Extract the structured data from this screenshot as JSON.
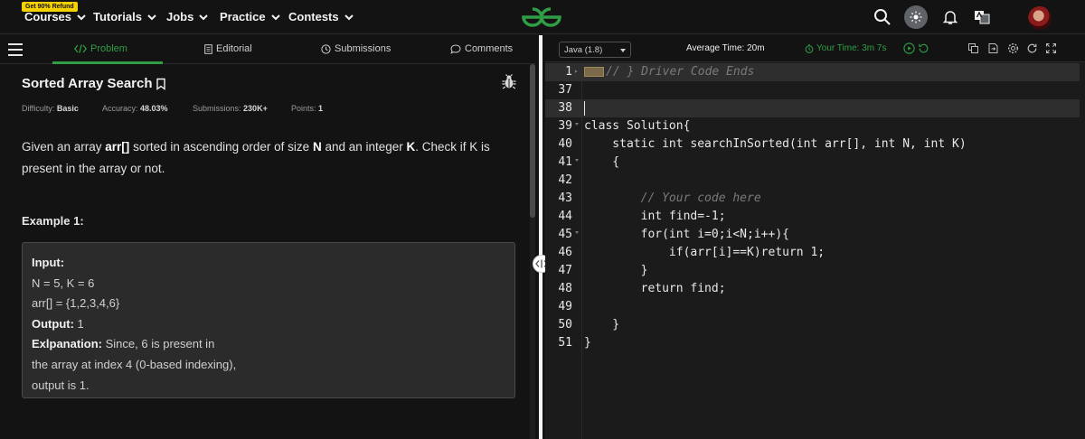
{
  "nav": {
    "refund_badge": "Get 90% Refund",
    "items": [
      "Courses",
      "Tutorials",
      "Jobs",
      "Practice",
      "Contests"
    ]
  },
  "tabs": {
    "problem": "Problem",
    "editorial": "Editorial",
    "submissions": "Submissions",
    "comments": "Comments"
  },
  "problem": {
    "title": "Sorted Array Search",
    "difficulty_label": "Difficulty:",
    "difficulty": "Basic",
    "accuracy_label": "Accuracy:",
    "accuracy": "48.03%",
    "submissions_label": "Submissions:",
    "submissions": "230K+",
    "points_label": "Points:",
    "points": "1",
    "desc_1": "Given an array ",
    "desc_arr": "arr[]",
    "desc_2": " sorted in ascending order of size ",
    "desc_n": "N",
    "desc_3": " and an integer ",
    "desc_k": "K",
    "desc_4": ". Check if K is present in the array or not.",
    "example_title": "Example 1:",
    "example": {
      "input_label": "Input:",
      "line1": "N = 5, K = 6",
      "line2": "arr[] = {1,2,3,4,6}",
      "output_label": "Output:",
      "output_value": " 1",
      "expl_label": "Exlpanation:",
      "expl_1": " Since, 6 is present in",
      "expl_2": "the array at index 4 (0-based indexing),",
      "expl_3": "output is 1."
    }
  },
  "editor": {
    "language": "Java (1.8)",
    "avg_time": "Average Time: 20m",
    "your_time": "Your Time: 3m 7s",
    "lines": [
      {
        "n": "1",
        "code": "// } Driver Code Ends"
      },
      {
        "n": "37",
        "code": ""
      },
      {
        "n": "38",
        "code": ""
      },
      {
        "n": "39",
        "code": "class Solution{"
      },
      {
        "n": "40",
        "code": "    static int searchInSorted(int arr[], int N, int K)"
      },
      {
        "n": "41",
        "code": "    {"
      },
      {
        "n": "42",
        "code": ""
      },
      {
        "n": "43",
        "code": "        // Your code here"
      },
      {
        "n": "44",
        "code": "        int find=-1;"
      },
      {
        "n": "45",
        "code": "        for(int i=0;i<N;i++){"
      },
      {
        "n": "46",
        "code": "            if(arr[i]==K)return 1;"
      },
      {
        "n": "47",
        "code": "        }"
      },
      {
        "n": "48",
        "code": "        return find;"
      },
      {
        "n": "49",
        "code": ""
      },
      {
        "n": "50",
        "code": "    }"
      },
      {
        "n": "51",
        "code": "}"
      }
    ]
  },
  "colors": {
    "accent_green": "#2f9e44",
    "code_keyword": "#d7a96b"
  }
}
